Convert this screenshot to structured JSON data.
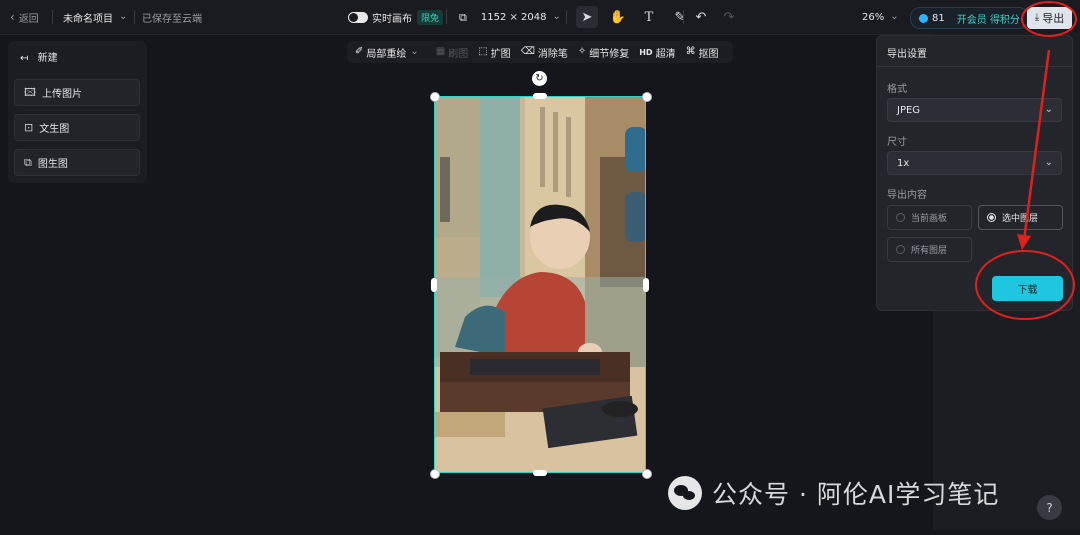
{
  "topbar": {
    "back_label": "返回",
    "project_name": "未命名项目",
    "save_status": "已保存至云端",
    "realtime_label": "实时画布",
    "realtime_badge": "限免",
    "canvas_size": "1152 × 2048",
    "zoom": "26%",
    "credits": "81",
    "member_label": "开会员 得积分",
    "export_label": "导出"
  },
  "left_panel": {
    "new_label": "新建",
    "buttons": [
      "上传图片",
      "文生图",
      "图生图"
    ]
  },
  "sub_toolbar": {
    "items": [
      {
        "label": "局部重绘",
        "enabled": true
      },
      {
        "label": "刷图",
        "enabled": false
      },
      {
        "label": "扩图",
        "enabled": true
      },
      {
        "label": "消除笔",
        "enabled": true
      },
      {
        "label": "细节修复",
        "enabled": true
      },
      {
        "label": "超清",
        "prefix": "HD",
        "enabled": true
      },
      {
        "label": "抠图",
        "enabled": true
      }
    ]
  },
  "export_panel": {
    "title": "导出设置",
    "format_label": "格式",
    "format_value": "JPEG",
    "size_label": "尺寸",
    "size_value": "1x",
    "content_label": "导出内容",
    "options": [
      "当前画板",
      "选中图层",
      "所有图层"
    ],
    "selected_option": "选中图层",
    "download_label": "下载"
  },
  "watermark": "公众号 · 阿伦AI学习笔记",
  "help_label": "?",
  "colors": {
    "accent": "#2ed3c2",
    "download": "#1fc6df",
    "annotation": "#e0201c"
  }
}
